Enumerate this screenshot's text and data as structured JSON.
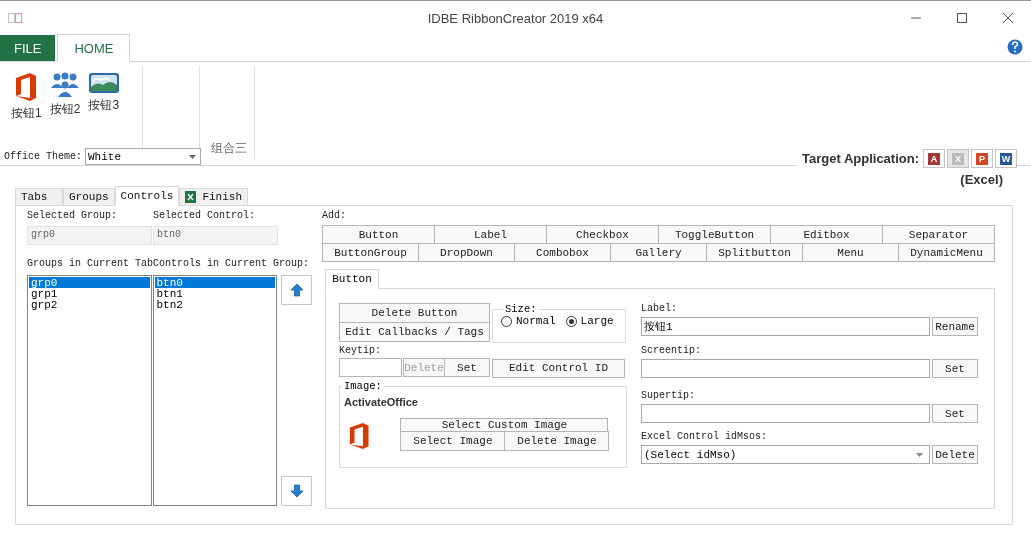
{
  "window": {
    "title": "IDBE RibbonCreator 2019 x64"
  },
  "ribbon": {
    "tabs": [
      {
        "label": "FILE",
        "kind": "file",
        "selected": false
      },
      {
        "label": "HOME",
        "kind": "tab",
        "selected": true
      }
    ],
    "groups": [
      {
        "kind": "group",
        "buttons": [
          {
            "label": "按钮1",
            "kind": "office"
          },
          {
            "label": "按钮2",
            "kind": "people"
          },
          {
            "label": "按钮3",
            "kind": "picture"
          }
        ]
      },
      {
        "kind": "group"
      },
      {
        "kind": "group",
        "label": "组合三"
      }
    ]
  },
  "office_theme": {
    "label": "Office Theme:",
    "value": "White"
  },
  "target_application": {
    "label": "Target Application:",
    "current": "(Excel)",
    "apps": [
      {
        "letter": "A",
        "color": "#a4373a",
        "selected": false
      },
      {
        "letter": "X",
        "color": "#b9b9b9",
        "selected": true
      },
      {
        "letter": "P",
        "color": "#d24726",
        "selected": false
      },
      {
        "letter": "W",
        "color": "#2b579a",
        "selected": false
      }
    ]
  },
  "tabs": [
    {
      "label": "Tabs",
      "selected": false
    },
    {
      "label": "Groups",
      "selected": false
    },
    {
      "label": "Controls",
      "selected": true
    },
    {
      "label": "Finish",
      "selected": false,
      "kind": "excel"
    }
  ],
  "controls_page": {
    "selected_group": {
      "label": "Selected Group:",
      "value": "grp0"
    },
    "selected_control": {
      "label": "Selected Control:",
      "value": "btn0"
    },
    "groups_label": "Groups in Current Tab",
    "controls_label": "Controls in Current Group:",
    "groups": [
      {
        "label": "grp0",
        "selected": true
      },
      {
        "label": "grp1",
        "selected": false
      },
      {
        "label": "grp2",
        "selected": false
      }
    ],
    "controls": [
      {
        "label": "btn0",
        "selected": true
      },
      {
        "label": "btn1",
        "selected": false
      },
      {
        "label": "btn2",
        "selected": false
      }
    ],
    "add": {
      "label": "Add:",
      "rows": [
        {
          "buttons": [
            "Button",
            "Label",
            "Checkbox",
            "ToggleButton",
            "Editbox",
            "Separator"
          ]
        },
        {
          "buttons": [
            "ButtonGroup",
            "DropDown",
            "Combobox",
            "Gallery",
            "Splitbutton",
            "Menu",
            "DynamicMenu"
          ]
        }
      ]
    },
    "editor": {
      "tab": "Button",
      "delete_button": "Delete Button",
      "edit_callbacks": "Edit Callbacks / Tags",
      "size": {
        "label": "Size:",
        "options": [
          {
            "label": "Normal",
            "selected": false
          },
          {
            "label": "Large",
            "selected": true
          }
        ]
      },
      "keytip": {
        "label": "Keytip:",
        "buttons": [
          {
            "label": "Delete",
            "disabled": true
          },
          {
            "label": "Set",
            "disabled": false
          }
        ]
      },
      "edit_id": "Edit Control ID",
      "image": {
        "label": "Image:",
        "name": "ActivateOffice",
        "custom": "Select Custom Image",
        "select": "Select Image",
        "delete": "Delete Image"
      },
      "fields": [
        {
          "label": "Label:",
          "value": "按钮1",
          "button": "Rename",
          "kind": "text"
        },
        {
          "label": "Screentip:",
          "button": "Set",
          "kind": "text"
        },
        {
          "label": "Supertip:",
          "button": "Set",
          "kind": "text"
        },
        {
          "label": "Excel Control idMsos:",
          "value": "(Select idMso)",
          "button": "Delete",
          "kind": "select"
        }
      ]
    }
  }
}
